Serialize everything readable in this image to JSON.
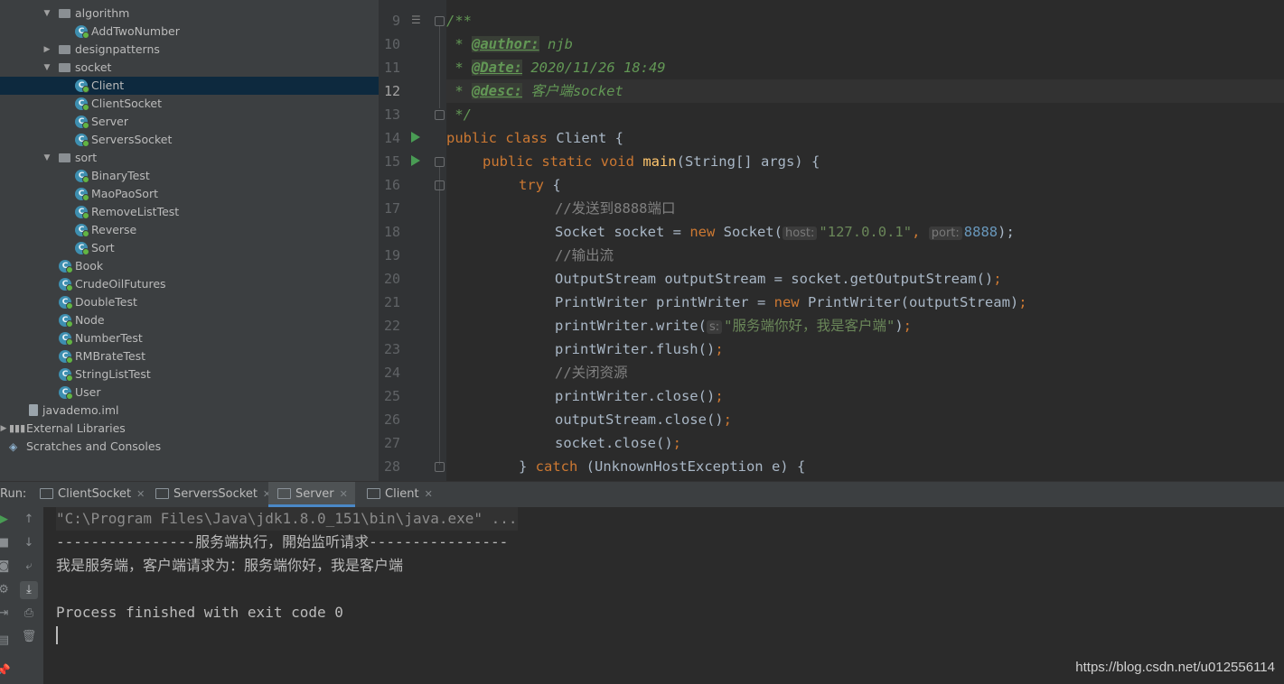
{
  "colors": {
    "keyword": "#cc7832",
    "function": "#ffc66d",
    "string": "#6a8759",
    "number": "#6897bb",
    "comment": "#808080",
    "doc": "#629755",
    "run_arrow": "#499c54",
    "selection": "#0d293e"
  },
  "project_tree": {
    "items": [
      {
        "label": "algorithm",
        "kind": "folder",
        "expanded": true
      },
      {
        "label": "AddTwoNumber",
        "kind": "class"
      },
      {
        "label": "designpatterns",
        "kind": "folder",
        "expanded": false
      },
      {
        "label": "socket",
        "kind": "folder",
        "expanded": true
      },
      {
        "label": "Client",
        "kind": "class",
        "selected": true
      },
      {
        "label": "ClientSocket",
        "kind": "class"
      },
      {
        "label": "Server",
        "kind": "class"
      },
      {
        "label": "ServersSocket",
        "kind": "class"
      },
      {
        "label": "sort",
        "kind": "folder",
        "expanded": true
      },
      {
        "label": "BinaryTest",
        "kind": "class"
      },
      {
        "label": "MaoPaoSort",
        "kind": "class"
      },
      {
        "label": "RemoveListTest",
        "kind": "class"
      },
      {
        "label": "Reverse",
        "kind": "class"
      },
      {
        "label": "Sort",
        "kind": "class"
      },
      {
        "label": "Book",
        "kind": "class"
      },
      {
        "label": "CrudeOilFutures",
        "kind": "class"
      },
      {
        "label": "DoubleTest",
        "kind": "class"
      },
      {
        "label": "Node",
        "kind": "class"
      },
      {
        "label": "NumberTest",
        "kind": "class"
      },
      {
        "label": "RMBrateTest",
        "kind": "class"
      },
      {
        "label": "StringListTest",
        "kind": "class"
      },
      {
        "label": "User",
        "kind": "class"
      },
      {
        "label": "javademo.iml",
        "kind": "file"
      },
      {
        "label": "External Libraries",
        "kind": "libraries"
      },
      {
        "label": "Scratches and Consoles",
        "kind": "scratches"
      }
    ]
  },
  "editor": {
    "current_line": "12",
    "line_numbers": [
      "9",
      "10",
      "11",
      "12",
      "13",
      "14",
      "15",
      "16",
      "17",
      "18",
      "19",
      "20",
      "21",
      "22",
      "23",
      "24",
      "25",
      "26",
      "27",
      "28"
    ],
    "code": {
      "l9": "/**",
      "l10_star": " * ",
      "l10_tag": "@author:",
      "l10_val": " njb",
      "l11_star": " * ",
      "l11_tag": "@Date:",
      "l11_val": " 2020/11/26 18:49",
      "l12_star": " * ",
      "l12_tag": "@desc:",
      "l12_val": " 客户端socket",
      "l13": " */",
      "l14_kw": "public class ",
      "l14_rest": "Client {",
      "l15_kw": "public static void ",
      "l15_fn": "main",
      "l15_rest": "(String[] args) {",
      "l16_kw": "try",
      "l16_rest": " {",
      "l17": "//发送到8888端口",
      "l18_a": "Socket socket = ",
      "l18_new": "new ",
      "l18_b": "Socket(",
      "l18_hint1": "host:",
      "l18_str": "\"127.0.0.1\"",
      "l18_comma": ", ",
      "l18_hint2": "port:",
      "l18_num": "8888",
      "l18_end": ");",
      "l19": "//输出流",
      "l20_a": "OutputStream outputStream = socket.getOutputStream()",
      "l20_semi": ";",
      "l21_a": "PrintWriter printWriter = ",
      "l21_new": "new ",
      "l21_b": "PrintWriter(outputStream)",
      "l21_semi": ";",
      "l22_a": "printWriter.write(",
      "l22_hint": "s:",
      "l22_str": "\"服务端你好，我是客户端\"",
      "l22_b": ")",
      "l22_semi": ";",
      "l23_a": "printWriter.flush()",
      "l23_semi": ";",
      "l24": "//关闭资源",
      "l25_a": "printWriter.close()",
      "l25_semi": ";",
      "l26_a": "outputStream.close()",
      "l26_semi": ";",
      "l27_a": "socket.close()",
      "l27_semi": ";",
      "l28_a": "} ",
      "l28_kw": "catch",
      "l28_b": " (UnknownHostException e) {"
    }
  },
  "run_panel": {
    "label": "Run:",
    "tabs": [
      {
        "label": "ClientSocket",
        "active": false
      },
      {
        "label": "ServersSocket",
        "active": false
      },
      {
        "label": "Server",
        "active": true
      },
      {
        "label": "Client",
        "active": false
      }
    ],
    "close_glyph": "✕",
    "console": [
      "\"C:\\Program Files\\Java\\jdk1.8.0_151\\bin\\java.exe\" ...",
      "----------------服务端执行，開始监听请求----------------",
      "我是服务端，客户端请求为：服务端你好，我是客户端",
      "Process finished with exit code 0"
    ]
  },
  "watermark": "https://blog.csdn.net/u012556114"
}
